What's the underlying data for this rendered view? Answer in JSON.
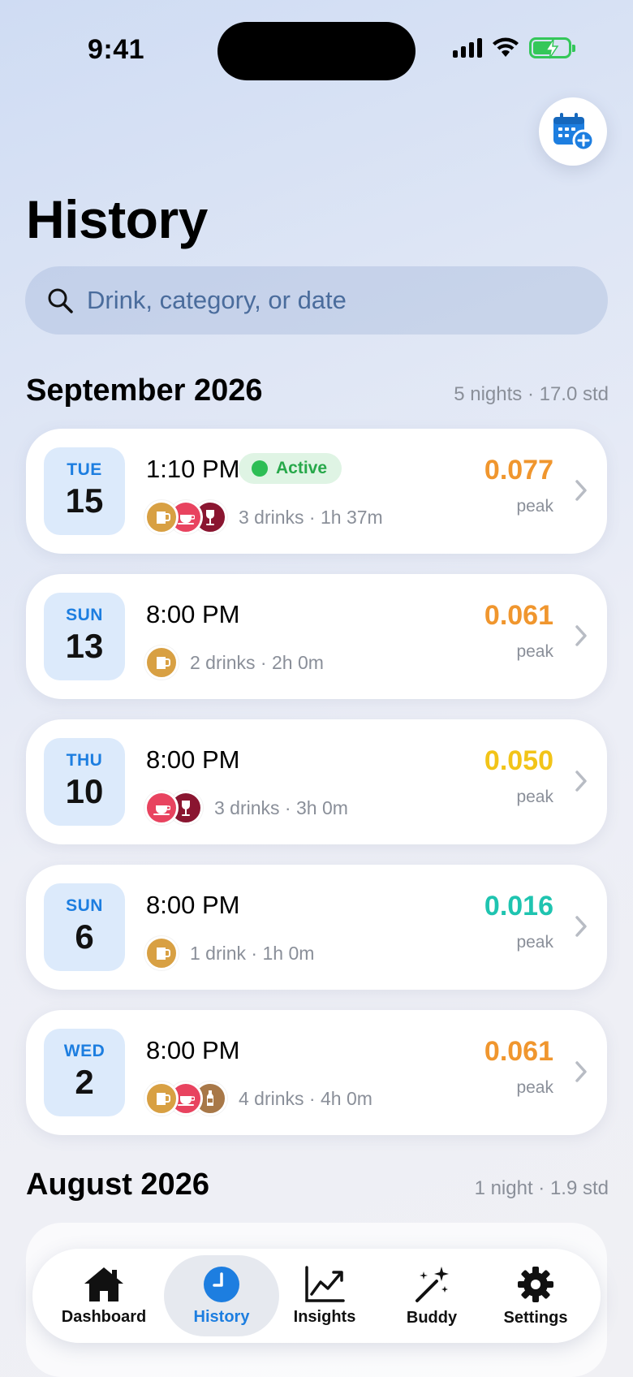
{
  "status_bar": {
    "time": "9:41"
  },
  "header": {
    "title": "History"
  },
  "search": {
    "placeholder": "Drink, category, or date"
  },
  "sections": [
    {
      "title": "September 2026",
      "meta": "5 nights · 17.0 std"
    },
    {
      "title": "August 2026",
      "meta": "1 night · 1.9 std"
    }
  ],
  "sessions": [
    {
      "dow": "TUE",
      "day": "15",
      "time": "1:10 PM",
      "active": true,
      "active_label": "Active",
      "drinks": [
        "beer",
        "coffee-cup",
        "wine"
      ],
      "summary": "3 drinks · 1h 37m",
      "peak": "0.077",
      "peak_label": "peak",
      "peak_color": "#f0962e"
    },
    {
      "dow": "SUN",
      "day": "13",
      "time": "8:00 PM",
      "active": false,
      "drinks": [
        "beer"
      ],
      "summary": "2 drinks · 2h 0m",
      "peak": "0.061",
      "peak_label": "peak",
      "peak_color": "#f0962e"
    },
    {
      "dow": "THU",
      "day": "10",
      "time": "8:00 PM",
      "active": false,
      "drinks": [
        "coffee-cup",
        "wine"
      ],
      "summary": "3 drinks · 3h 0m",
      "peak": "0.050",
      "peak_label": "peak",
      "peak_color": "#f2c418"
    },
    {
      "dow": "SUN",
      "day": "6",
      "time": "8:00 PM",
      "active": false,
      "drinks": [
        "beer"
      ],
      "summary": "1 drink · 1h 0m",
      "peak": "0.016",
      "peak_label": "peak",
      "peak_color": "#1fc4b0"
    },
    {
      "dow": "WED",
      "day": "2",
      "time": "8:00 PM",
      "active": false,
      "drinks": [
        "beer",
        "coffee-cup",
        "bottle"
      ],
      "summary": "4 drinks · 4h 0m",
      "peak": "0.061",
      "peak_label": "peak",
      "peak_color": "#f0962e"
    }
  ],
  "tabs": [
    {
      "label": "Dashboard",
      "icon": "house-icon",
      "active": false
    },
    {
      "label": "History",
      "icon": "clock-icon",
      "active": true
    },
    {
      "label": "Insights",
      "icon": "chart-icon",
      "active": false
    },
    {
      "label": "Buddy",
      "icon": "magic-wand-icon",
      "active": false
    },
    {
      "label": "Settings",
      "icon": "gear-icon",
      "active": false
    }
  ],
  "colors": {
    "accent": "#1d7ee0",
    "beer": "#d8a043",
    "coffee-cup": "#e8435f",
    "wine": "#8a1530",
    "bottle": "#a87848"
  }
}
